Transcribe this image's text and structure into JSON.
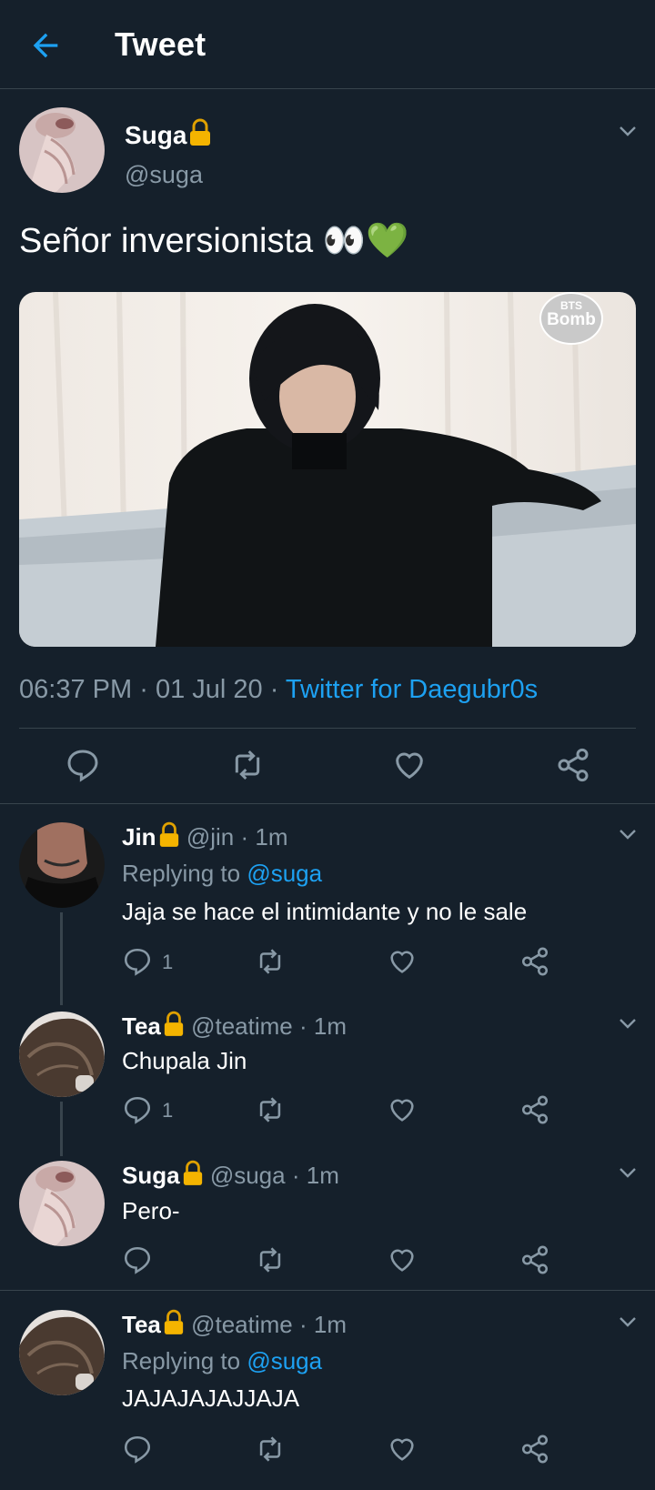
{
  "header": {
    "title": "Tweet"
  },
  "main_tweet": {
    "name": "Suga",
    "handle": "@suga",
    "text": "Señor inversionista 👀💚",
    "watermark_top": "BTS",
    "watermark_bottom": "Bomb",
    "time": "06:37 PM",
    "date": "01 Jul 20",
    "sep": "·",
    "source": "Twitter for Daegubr0s"
  },
  "replies": [
    {
      "name": "Jin",
      "handle": "@jin",
      "time": "1m",
      "replying_label": "Replying to",
      "replying_to": "@suga",
      "text": "Jaja se hace el intimidante y no le sale",
      "reply_count": "1"
    },
    {
      "name": "Tea",
      "handle": "@teatime",
      "time": "1m",
      "text": "Chupala Jin",
      "reply_count": "1"
    },
    {
      "name": "Suga",
      "handle": "@suga",
      "time": "1m",
      "text": "Pero-"
    },
    {
      "name": "Tea",
      "handle": "@teatime",
      "time": "1m",
      "replying_label": "Replying to",
      "replying_to": "@suga",
      "text": "JAJAJAJAJJAJA"
    }
  ],
  "colors": {
    "background": "#15202b",
    "accent": "#1da1f2",
    "muted": "#8899a6",
    "divider": "#38444d",
    "lock": "#f4b400"
  }
}
